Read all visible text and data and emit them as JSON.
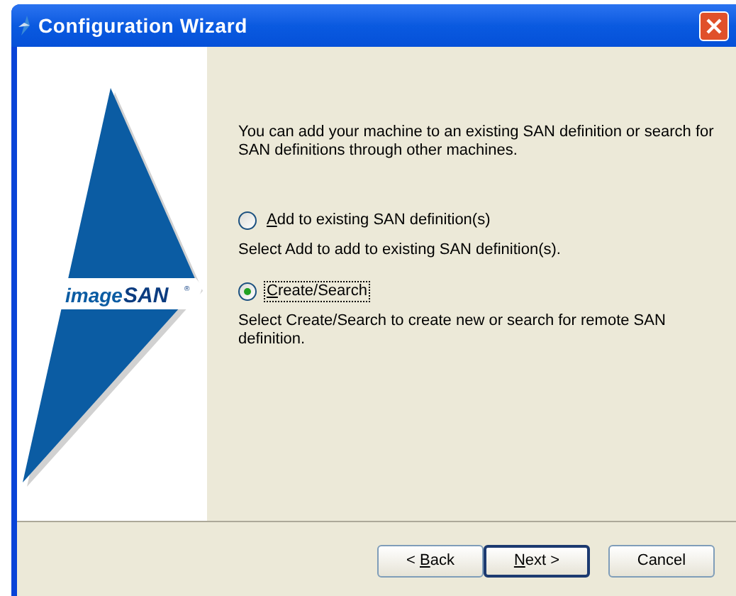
{
  "window": {
    "title": "Configuration Wizard"
  },
  "logo": {
    "text_1": "image",
    "text_2": "SAN",
    "mark": "®"
  },
  "intro": "You can add your machine to an existing SAN definition or search for SAN definitions through other machines.",
  "options": [
    {
      "label": {
        "key": "A",
        "after": "dd to existing SAN definition(s)"
      },
      "selected": false,
      "focused": false,
      "description": "Select Add to add to existing SAN definition(s)."
    },
    {
      "label": {
        "key": "C",
        "after": "reate/Search"
      },
      "selected": true,
      "focused": true,
      "description": "Select Create/Search to create new or search for remote SAN definition."
    }
  ],
  "buttons": [
    {
      "label": {
        "before": "< ",
        "key": "B",
        "after": "ack"
      },
      "default": false
    },
    {
      "label": {
        "key": "N",
        "after": "ext >"
      },
      "default": true
    },
    {
      "label": {
        "after": "Cancel"
      },
      "default": false
    }
  ]
}
